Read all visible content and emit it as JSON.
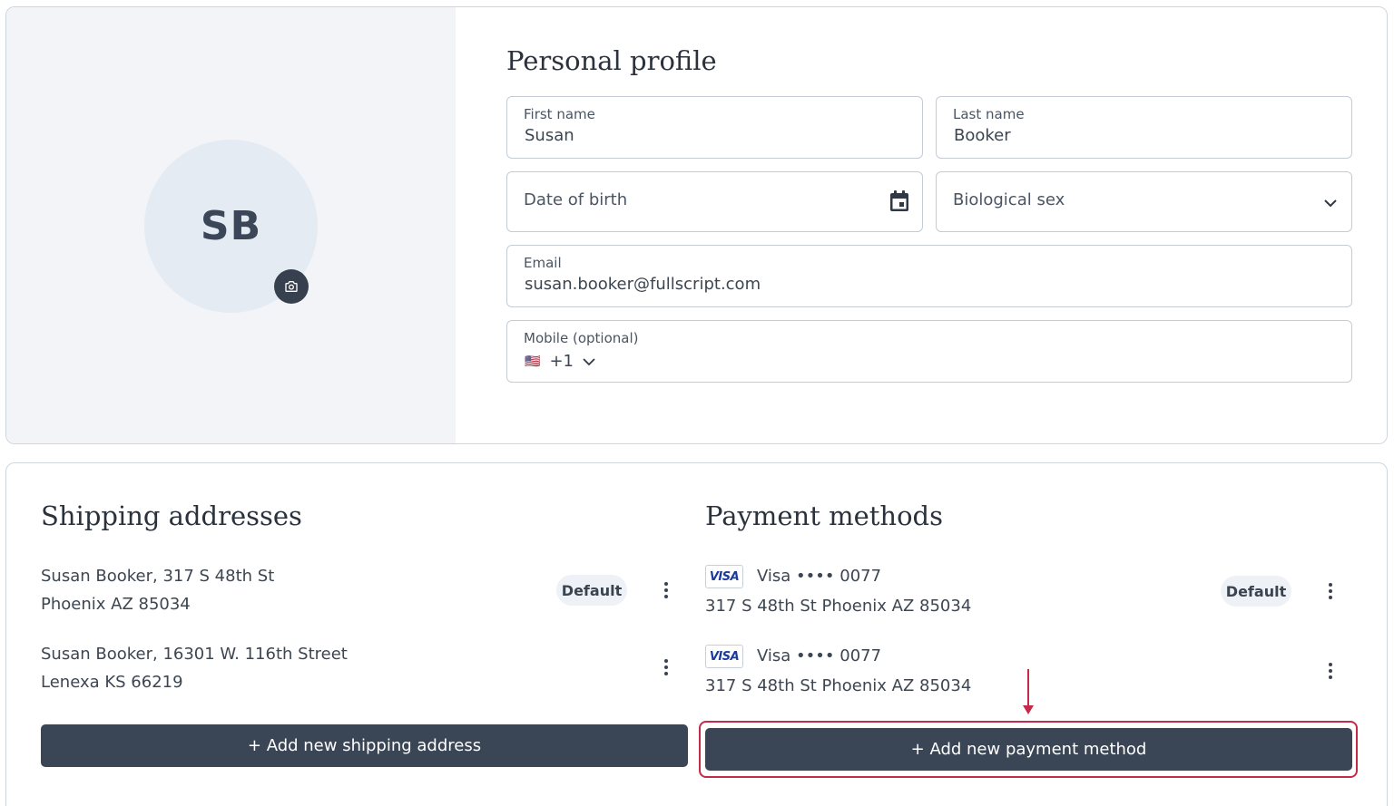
{
  "profile": {
    "initials": "SB",
    "title": "Personal profile",
    "first_name": {
      "label": "First name",
      "value": "Susan"
    },
    "last_name": {
      "label": "Last name",
      "value": "Booker"
    },
    "dob": {
      "placeholder": "Date of birth",
      "icon": "calendar-icon"
    },
    "sex": {
      "placeholder": "Biological sex",
      "icon": "chevron-down-icon"
    },
    "email": {
      "label": "Email",
      "value": "susan.booker@fullscript.com"
    },
    "mobile": {
      "label": "Mobile (optional)",
      "flag": "🇺🇸",
      "code": "+1"
    }
  },
  "shipping": {
    "title": "Shipping addresses",
    "addresses": [
      {
        "line1": "Susan Booker, 317 S 48th St",
        "line2": "Phoenix AZ 85034",
        "badge": "Default"
      },
      {
        "line1": "Susan Booker, 16301 W. 116th Street",
        "line2": "Lenexa KS 66219"
      }
    ],
    "add_label": "+ Add new shipping address"
  },
  "payment": {
    "title": "Payment methods",
    "methods": [
      {
        "brand": "VISA",
        "label": "Visa •••• 0077",
        "address": "317 S 48th St Phoenix AZ 85034",
        "badge": "Default"
      },
      {
        "brand": "VISA",
        "label": "Visa •••• 0077",
        "address": "317 S 48th St Phoenix AZ 85034"
      }
    ],
    "add_label": "+ Add new payment method"
  },
  "colors": {
    "accent": "#3a4556",
    "highlight": "#c52a4a"
  }
}
